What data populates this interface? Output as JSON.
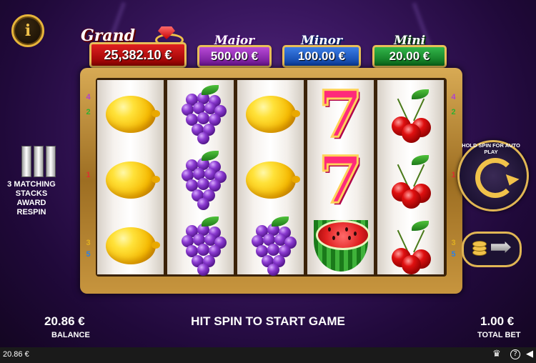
{
  "jackpots": {
    "grand": {
      "title": "Grand",
      "value": "25,382.10 €"
    },
    "major": {
      "title": "Major",
      "value": "500.00 €"
    },
    "minor": {
      "title": "Minor",
      "value": "100.00 €"
    },
    "mini": {
      "title": "Mini",
      "value": "20.00 €"
    }
  },
  "paylines": {
    "left": [
      "4",
      "2",
      "1",
      "3",
      "5"
    ],
    "right": [
      "4",
      "2",
      "1",
      "3",
      "5"
    ],
    "colors": {
      "1": "#e03030",
      "2": "#30b030",
      "3": "#e0b020",
      "4": "#b040d0",
      "5": "#3080e0"
    }
  },
  "reels": [
    [
      "lemon",
      "lemon",
      "lemon"
    ],
    [
      "grapes",
      "grapes",
      "grapes"
    ],
    [
      "lemon",
      "lemon",
      "grapes"
    ],
    [
      "seven",
      "seven",
      "watermelon"
    ],
    [
      "cherries",
      "cherries",
      "cherries"
    ]
  ],
  "seven_glyph": "7",
  "feature": {
    "text": "3 MATCHING STACKS AWARD RESPIN"
  },
  "spin_button": {
    "hint": "HOLD SPIN FOR AUTO PLAY"
  },
  "info_button": {
    "label": "i"
  },
  "balance": {
    "value": "20.86 €",
    "label": "BALANCE"
  },
  "total_bet": {
    "value": "1.00 €",
    "label": "TOTAL BET"
  },
  "message": "HIT SPIN TO START GAME",
  "status_bar": {
    "balance": "20.86 €",
    "icons": [
      "crown-icon",
      "help-icon",
      "speaker-icon"
    ]
  }
}
